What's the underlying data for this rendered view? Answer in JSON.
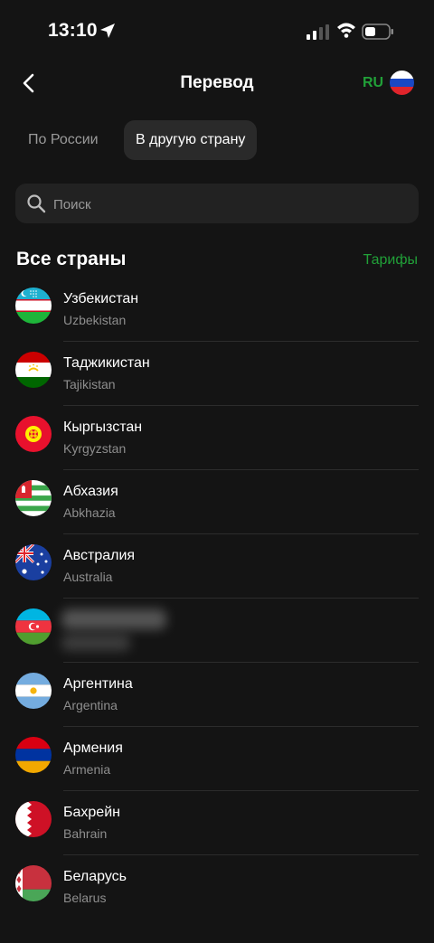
{
  "status_bar": {
    "time": "13:10"
  },
  "header": {
    "title": "Перевод",
    "language": "RU"
  },
  "tabs": [
    {
      "label": "По России",
      "active": false
    },
    {
      "label": "В другую страну",
      "active": true
    }
  ],
  "search": {
    "placeholder": "Поиск"
  },
  "section": {
    "title": "Все страны",
    "tariffs_link": "Тарифы"
  },
  "countries": [
    {
      "name": "Узбекистан",
      "sub": "Uzbekistan",
      "flag": "uzbekistan-flag-icon"
    },
    {
      "name": "Таджикистан",
      "sub": "Tajikistan",
      "flag": "tajikistan-flag-icon"
    },
    {
      "name": "Кыргызстан",
      "sub": "Kyrgyzstan",
      "flag": "kyrgyzstan-flag-icon"
    },
    {
      "name": "Абхазия",
      "sub": "Abkhazia",
      "flag": "abkhazia-flag-icon"
    },
    {
      "name": "Австралия",
      "sub": "Australia",
      "flag": "australia-flag-icon"
    },
    {
      "name": "",
      "sub": "",
      "flag": "azerbaijan-flag-icon",
      "redacted": true
    },
    {
      "name": "Аргентина",
      "sub": "Argentina",
      "flag": "argentina-flag-icon"
    },
    {
      "name": "Армения",
      "sub": "Armenia",
      "flag": "armenia-flag-icon"
    },
    {
      "name": "Бахрейн",
      "sub": "Bahrain",
      "flag": "bahrain-flag-icon"
    },
    {
      "name": "Беларусь",
      "sub": "Belarus",
      "flag": "belarus-flag-icon"
    }
  ],
  "colors": {
    "background": "#141414",
    "accent": "#21a038",
    "muted": "#8e8e8e"
  }
}
